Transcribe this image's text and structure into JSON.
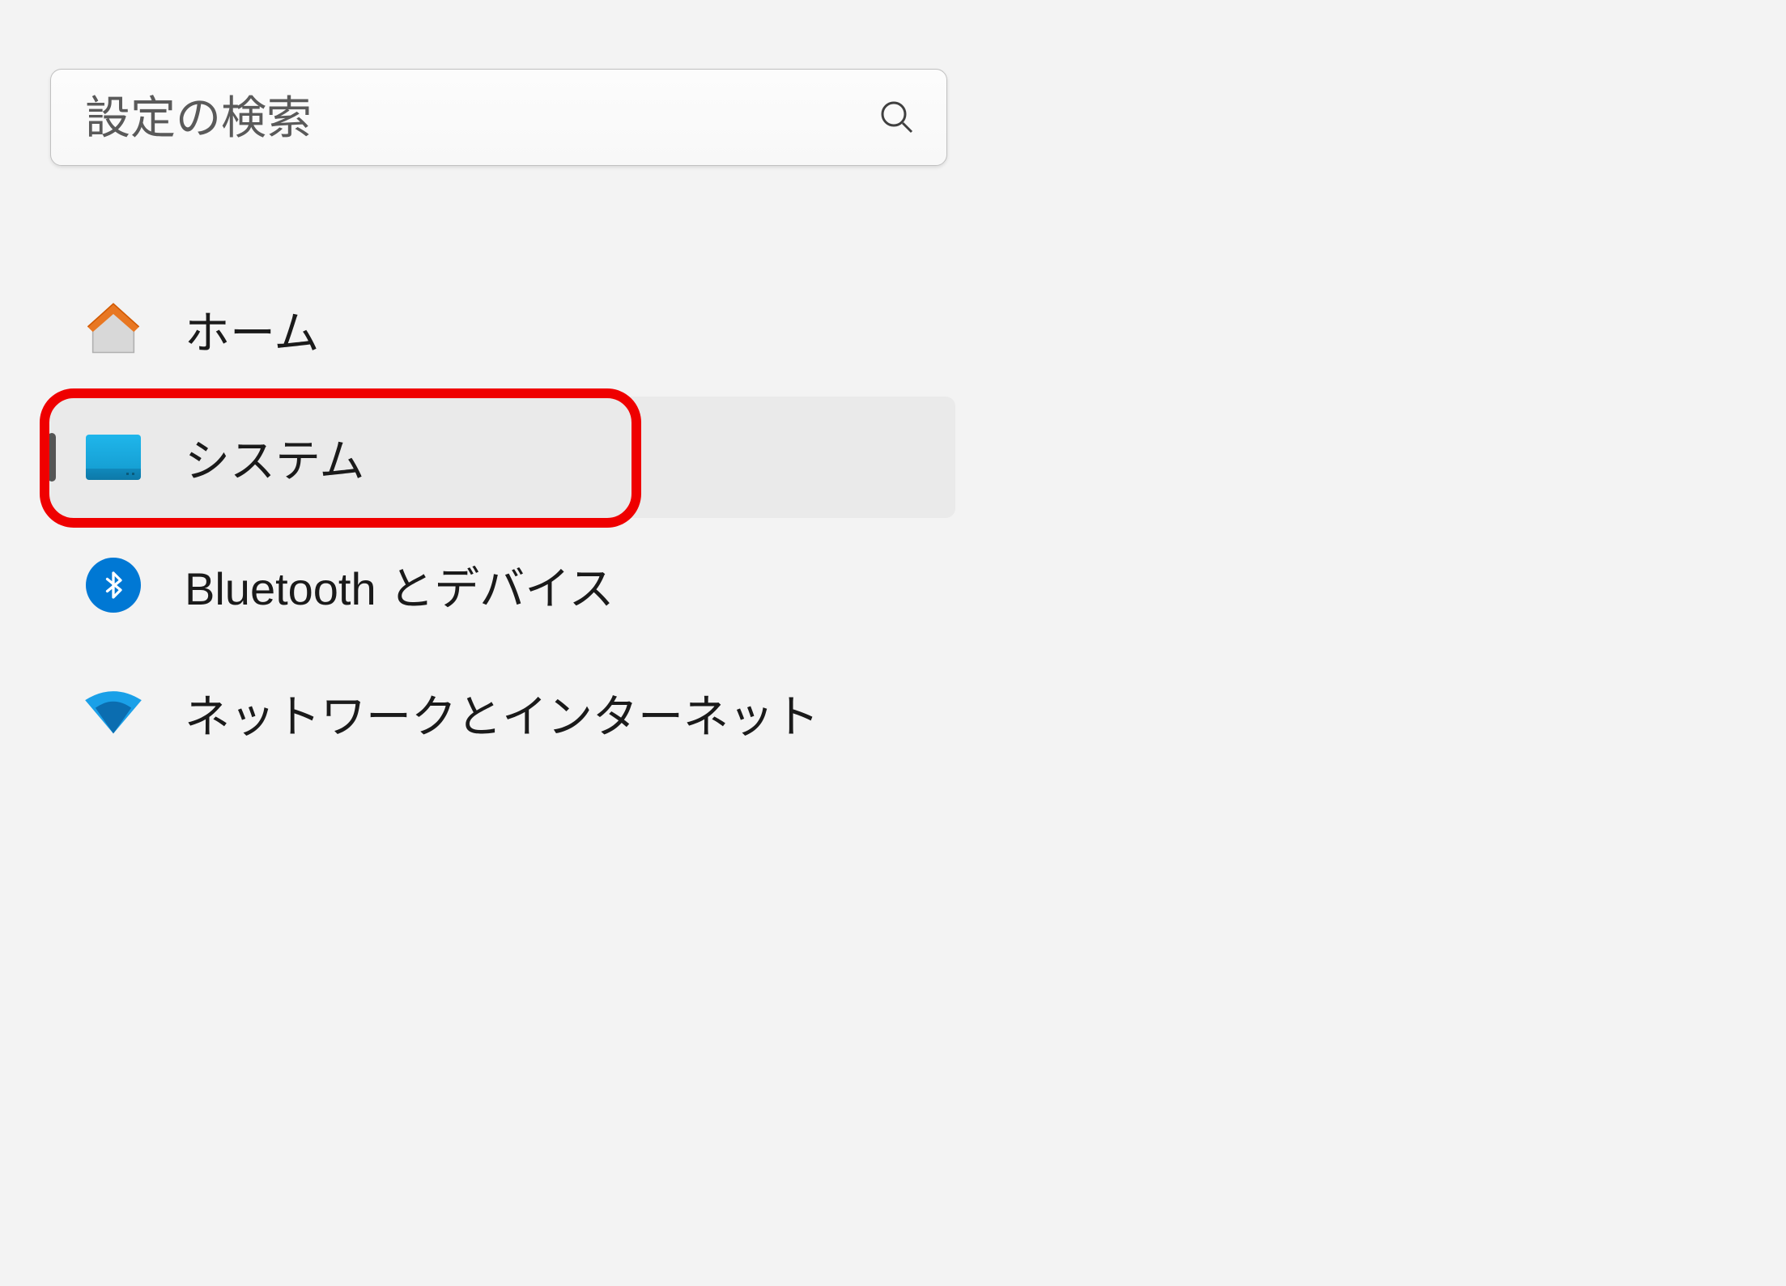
{
  "search": {
    "placeholder": "設定の検索"
  },
  "nav": {
    "items": [
      {
        "label": "ホーム",
        "icon": "home",
        "selected": false
      },
      {
        "label": "システム",
        "icon": "system",
        "selected": true
      },
      {
        "label": "Bluetooth とデバイス",
        "icon": "bluetooth",
        "selected": false
      },
      {
        "label": "ネットワークとインターネット",
        "icon": "network",
        "selected": false
      }
    ]
  },
  "highlight": {
    "target_index": 1,
    "color": "#ef0000"
  }
}
